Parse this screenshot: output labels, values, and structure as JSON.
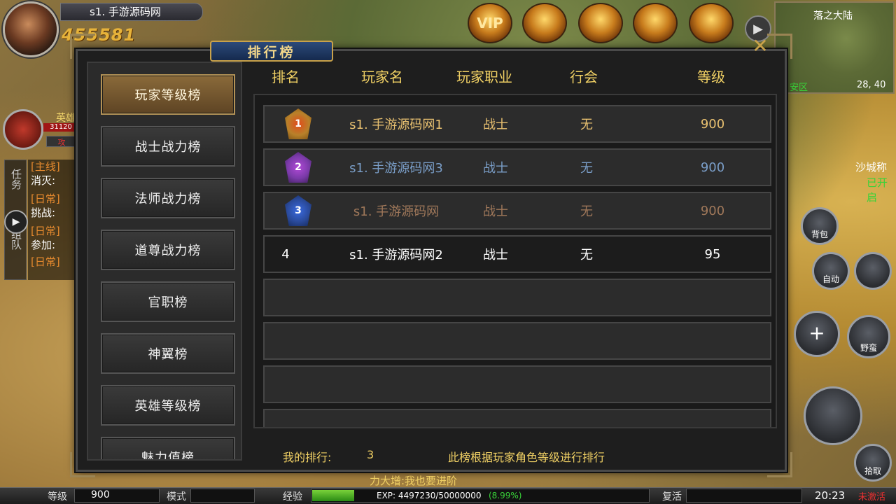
{
  "player": {
    "name": "s1. 手游源码网",
    "power": "455581"
  },
  "top_icons": [
    {
      "label": "VIP",
      "icon": "vip-crown-icon"
    },
    {
      "label": "",
      "icon": "treasure-chest-icon"
    },
    {
      "label": "",
      "icon": "gift-box-icon"
    },
    {
      "label": "",
      "icon": "cannon-icon"
    },
    {
      "label": "",
      "icon": "red-pouch-icon"
    }
  ],
  "minimap": {
    "name": "落之大陆",
    "coords": "28, 40",
    "zone": "安区"
  },
  "hero": {
    "label": "英雄",
    "hp": "31120",
    "attack": "攻"
  },
  "quest_sidebar": {
    "tab_task": "任务",
    "tab_team": "组队",
    "items": [
      {
        "type": "[主线]",
        "text": "消灭:"
      },
      {
        "type": "[日常]",
        "text": "挑战:"
      },
      {
        "type": "[日常]",
        "text": "参加:"
      },
      {
        "type": "[日常]",
        "text": ""
      }
    ]
  },
  "right_controls": {
    "sand_city": "沙城称",
    "opened": "已开启",
    "bag": "背包",
    "auto": "自动",
    "wild": "野蛮",
    "pickup": "拾取"
  },
  "panel": {
    "title": "排行榜",
    "close": "✕"
  },
  "categories": [
    "玩家等级榜",
    "战士战力榜",
    "法师战力榜",
    "道尊战力榜",
    "官职榜",
    "神翼榜",
    "英雄等级榜",
    "魅力值榜"
  ],
  "active_category": 0,
  "columns": {
    "rank": "排名",
    "name": "玩家名",
    "class": "玩家职业",
    "guild": "行会",
    "level": "等级"
  },
  "rows": [
    {
      "rank": "1",
      "name": "s1. 手游源码网1",
      "class": "战士",
      "guild": "无",
      "level": "900",
      "color": "#e8c070",
      "medal": "gold"
    },
    {
      "rank": "2",
      "name": "s1. 手游源码网3",
      "class": "战士",
      "guild": "无",
      "level": "900",
      "color": "#7a9ec8",
      "medal": "purple"
    },
    {
      "rank": "3",
      "name": "s1. 手游源码网",
      "class": "战士",
      "guild": "无",
      "level": "900",
      "color": "#a0785a",
      "medal": "blue"
    },
    {
      "rank": "4",
      "name": "s1. 手游源码网2",
      "class": "战士",
      "guild": "无",
      "level": "95",
      "color": "#ffffff",
      "medal": ""
    }
  ],
  "footer": {
    "my_rank_label": "我的排行:",
    "my_rank_value": "3",
    "note": "此榜根据玩家角色等级进行排行"
  },
  "bottom_bar": {
    "level_label": "等级",
    "level_value": "900",
    "mode_label": "模式",
    "exp_label": "经验",
    "exp_text": "EXP: 4497230/50000000",
    "exp_percent": "(8.99%)",
    "revive": "复活",
    "time": "20:23",
    "status": "未激活",
    "chat_ticker": "力大增:我也要进阶"
  },
  "colors": {
    "gold_text": "#f0d064",
    "status_red": "#e83030"
  }
}
